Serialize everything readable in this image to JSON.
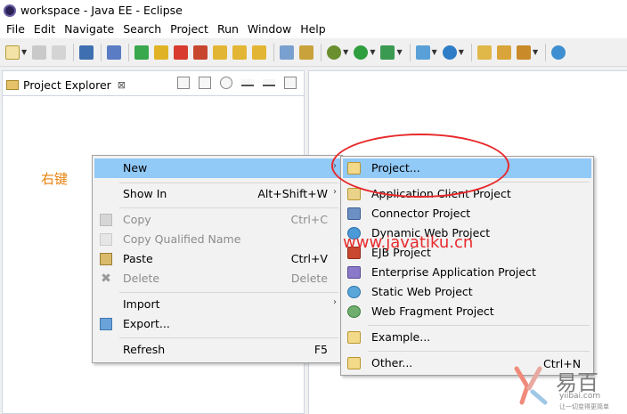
{
  "window": {
    "title": "workspace - Java EE - Eclipse"
  },
  "menubar": [
    "File",
    "Edit",
    "Navigate",
    "Search",
    "Project",
    "Run",
    "Window",
    "Help"
  ],
  "explorer": {
    "tab_label": "Project Explorer",
    "close_glyph": "⊠"
  },
  "annotation_label": "右键",
  "context_menu": {
    "new": "New",
    "show_in": "Show In",
    "show_in_accel": "Alt+Shift+W",
    "copy": "Copy",
    "copy_accel": "Ctrl+C",
    "copy_qualified": "Copy Qualified Name",
    "paste": "Paste",
    "paste_accel": "Ctrl+V",
    "delete": "Delete",
    "delete_accel": "Delete",
    "import": "Import",
    "export": "Export...",
    "refresh": "Refresh",
    "refresh_accel": "F5",
    "arrow": "›"
  },
  "new_submenu": {
    "project": "Project...",
    "app_client": "Application Client Project",
    "connector": "Connector Project",
    "dynamic_web": "Dynamic Web Project",
    "ejb": "EJB Project",
    "enterprise_app": "Enterprise Application Project",
    "static_web": "Static Web Project",
    "web_fragment": "Web Fragment Project",
    "example": "Example...",
    "other": "Other...",
    "other_accel": "Ctrl+N"
  },
  "watermark": "www.javatiku.cn",
  "logo": {
    "chinese": "易百",
    "english": "yiibai.com",
    "slogan": "让一切变得更简单"
  },
  "colors": {
    "highlight": "#91c9f7",
    "annotation_red": "#e8292b",
    "annotation_orange": "#e8820c"
  }
}
